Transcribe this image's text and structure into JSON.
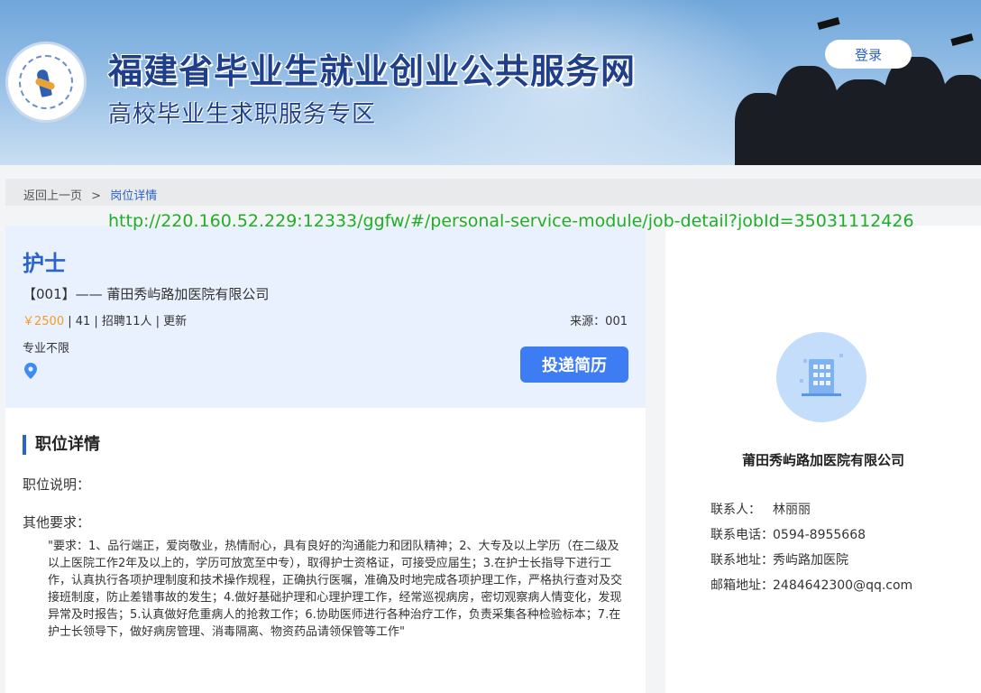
{
  "header": {
    "site_title": "福建省毕业生就业创业公共服务网",
    "site_subtitle": "高校毕业生求职服务专区",
    "login_label": "登录"
  },
  "breadcrumb": {
    "back_label": "返回上一页",
    "separator": ">",
    "current_label": "岗位详情"
  },
  "url_overlay": "http://220.160.52.229:12333/ggfw/#/personal-service-module/job-detail?jobId=35031112426",
  "job": {
    "title": "护士",
    "company_line": "【001】—— 莆田秀屿路加医院有限公司",
    "salary": "￥2500",
    "meta_rest": " | 41 | 招聘11人 | 更新",
    "source": "来源：001",
    "major": "专业不限",
    "apply_label": "投递简历"
  },
  "detail": {
    "section_title": "职位详情",
    "description_label": "职位说明：",
    "other_label": "其他要求：",
    "requirements_text": "\"要求：1、品行端正，爱岗敬业，热情耐心，具有良好的沟通能力和团队精神；2、大专及以上学历（在二级及以上医院工作2年及以上的，学历可放宽至中专），取得护士资格证，可接受应届生；3.在护士长指导下进行工作，认真执行各项护理制度和技术操作规程，正确执行医嘱，准确及时地完成各项护理工作，严格执行查对及交接班制度，防止差错事故的发生；4.做好基础护理和心理护理工作，经常巡视病房，密切观察病人情变化，发现异常及时报告；5.认真做好危重病人的抢救工作；6.协助医师进行各种治疗工作，负责采集各种检验标本；7.在护士长领导下，做好病房管理、消毒隔离、物资药品请领保管等工作\""
  },
  "company_card": {
    "name": "莆田秀屿路加医院有限公司",
    "contact_label": "联系人：",
    "contact_value": "林丽丽",
    "phone_label": "联系电话：",
    "phone_value": "0594-8955668",
    "address_label": "联系地址：",
    "address_value": "秀屿路加医院",
    "email_label": "邮箱地址：",
    "email_value": "2484642300@qq.com"
  },
  "colors": {
    "brand_blue": "#2a63c9",
    "apply_button": "#3d7cf3",
    "salary_orange": "#f29b2b",
    "url_green": "#1fae2a"
  },
  "icons": [
    "site-logo",
    "location-pin-icon",
    "building-icon"
  ]
}
